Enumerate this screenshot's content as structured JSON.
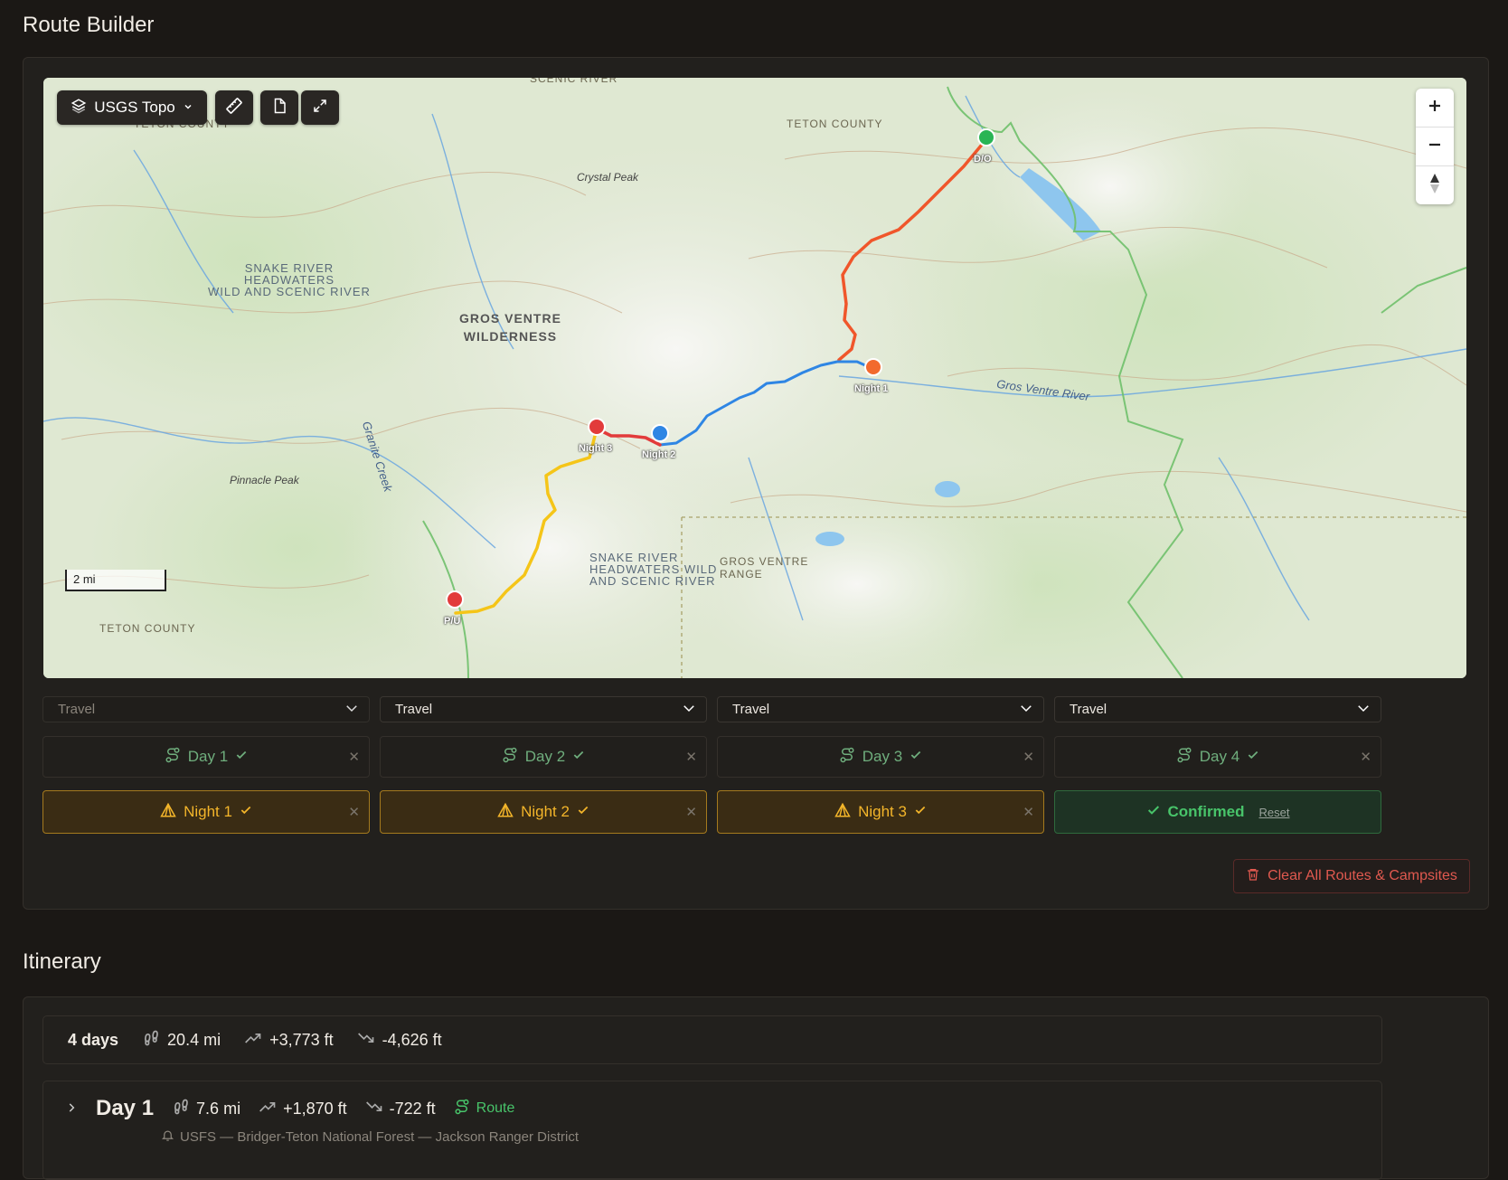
{
  "page": {
    "title": "Route Builder",
    "itinerary_title": "Itinerary"
  },
  "map": {
    "layer_label": "USGS Topo",
    "scale_label": "2 mi",
    "labels": {
      "teton_county_1": "TETON COUNTY",
      "teton_county_2": "TETON COUNTY",
      "teton_county_3": "TETON COUNTY",
      "scenic_river_top": "SCENIC RIVER",
      "snake_headwaters": "SNAKE RIVER\nHEADWATERS\nWILD AND SCENIC RIVER",
      "snake_headwaters_2": "SNAKE RIVER\nHEADWATERS WILD\nAND SCENIC RIVER",
      "gros_ventre_wilderness": "GROS VENTRE\nWILDERNESS",
      "gros_ventre_range": "GROS VENTRE\nRANGE",
      "crystal_peak": "Crystal Peak",
      "pinnacle_peak": "Pinnacle Peak",
      "granite_creek": "Granite Creek",
      "gros_ventre_river": "Gros Ventre River"
    },
    "markers": {
      "do": "D/O",
      "night1": "Night 1",
      "night2": "Night 2",
      "night3": "Night 3",
      "pu": "P/U"
    },
    "colors": {
      "day1": "#f0562b",
      "day2": "#2f86e4",
      "day3": "#e23b3b",
      "day4": "#f5c518"
    }
  },
  "travel_selects": [
    "Travel",
    "Travel",
    "Travel",
    "Travel"
  ],
  "days": [
    "Day 1",
    "Day 2",
    "Day 3",
    "Day 4"
  ],
  "nights": [
    "Night 1",
    "Night 2",
    "Night 3"
  ],
  "confirm": {
    "label": "Confirmed",
    "reset": "Reset"
  },
  "clear_label": "Clear All Routes & Campsites",
  "summary": {
    "days": "4 days",
    "distance": "20.4 mi",
    "gain": "+3,773 ft",
    "loss": "-4,626 ft"
  },
  "day1": {
    "title": "Day 1",
    "distance": "7.6 mi",
    "gain": "+1,870 ft",
    "loss": "-722 ft",
    "route_label": "Route",
    "land": "USFS — Bridger-Teton National Forest — Jackson Ranger District"
  }
}
